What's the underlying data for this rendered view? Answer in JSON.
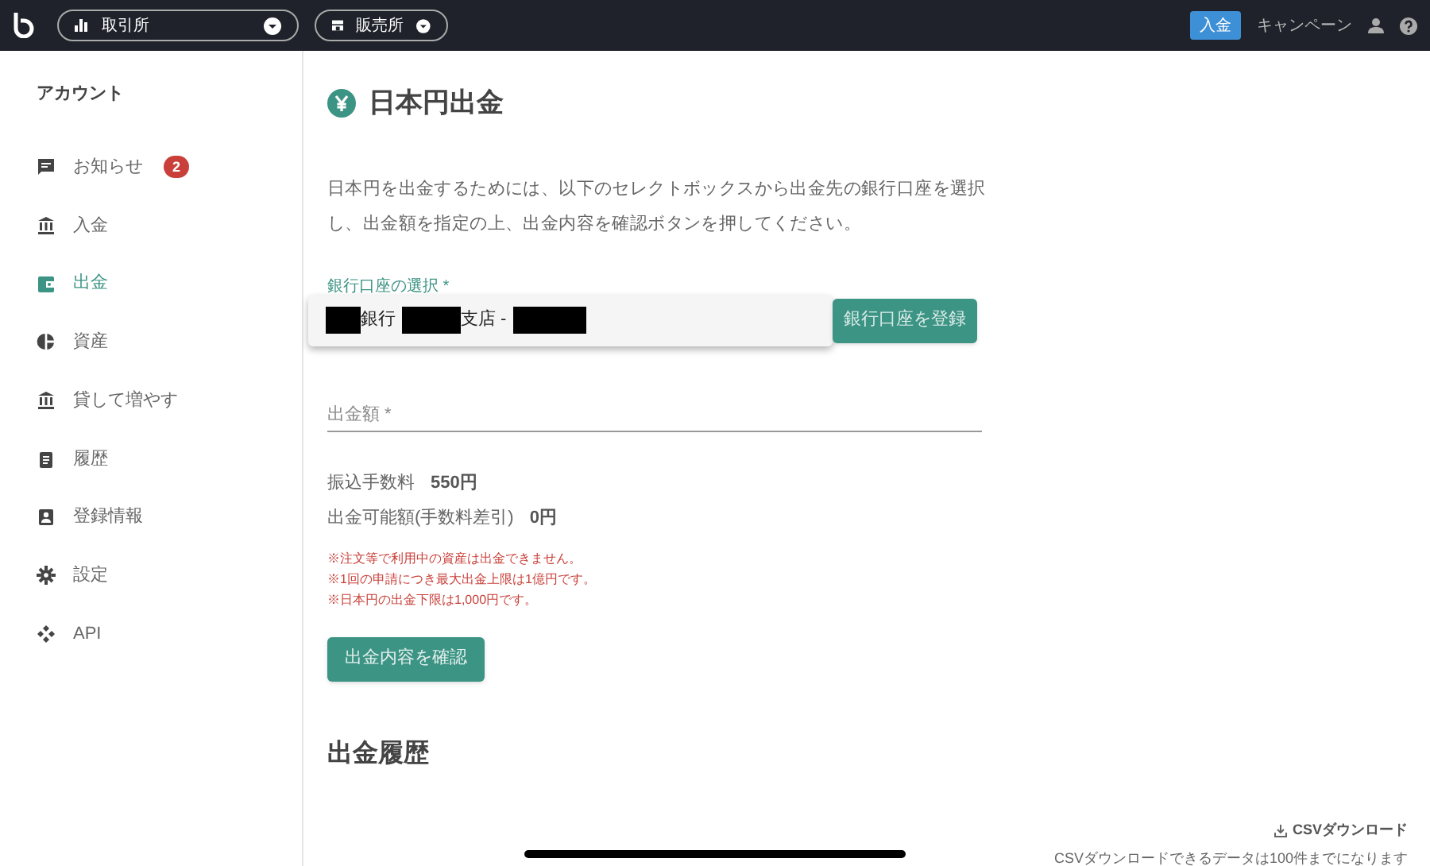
{
  "header": {
    "market_selector": "取引所",
    "shop_selector": "販売所",
    "deposit_button": "入金",
    "campaign_link": "キャンペーン"
  },
  "sidebar": {
    "heading": "アカウント",
    "items": [
      {
        "label": "お知らせ",
        "kind": "message",
        "selected": false,
        "badge": "2"
      },
      {
        "label": "入金",
        "kind": "bank",
        "selected": false
      },
      {
        "label": "出金",
        "kind": "wallet",
        "selected": true
      },
      {
        "label": "資産",
        "kind": "pie",
        "selected": false
      },
      {
        "label": "貸して増やす",
        "kind": "bank",
        "selected": false
      },
      {
        "label": "履歴",
        "kind": "clipboard",
        "selected": false
      },
      {
        "label": "登録情報",
        "kind": "badge",
        "selected": false
      },
      {
        "label": "設定",
        "kind": "gear",
        "selected": false
      },
      {
        "label": "API",
        "kind": "api",
        "selected": false
      }
    ]
  },
  "main": {
    "title": "日本円出金",
    "description": "日本円を出金するためには、以下のセレクトボックスから出金先の銀行口座を選択し、出金額を指定の上、出金内容を確認ボタンを押してください。",
    "account_select": {
      "label": "銀行口座の選択 *",
      "option_parts": [
        "銀行",
        "支店 -"
      ]
    },
    "register_button": "銀行口座を登録",
    "amount_field": {
      "placeholder": "出金額 *"
    },
    "fees": [
      {
        "label": "振込手数料",
        "value": "550円"
      },
      {
        "label": "出金可能額(手数料差引)",
        "value": "0円"
      }
    ],
    "notes": [
      "※注文等で利用中の資産は出金できません。",
      "※1回の申請につき最大出金上限は1億円です。",
      "※日本円の出金下限は1,000円です。"
    ],
    "confirm_button": "出金内容を確認",
    "history_title": "出金履歴",
    "csv_link": "CSVダウンロード",
    "csv_note": "CSVダウンロードできるデータは100件までになります"
  }
}
